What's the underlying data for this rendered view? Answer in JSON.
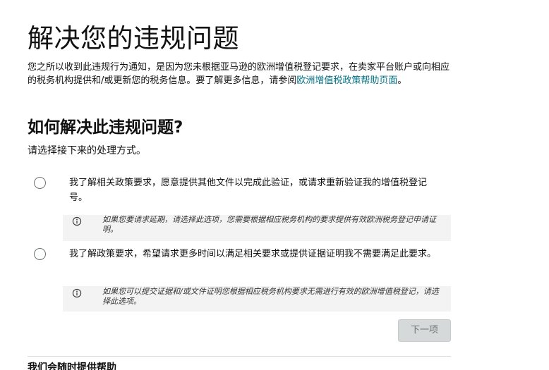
{
  "page": {
    "title": "解决您的违规问题",
    "intro_text": "您之所以收到此违规行为通知，是因为您未根据亚马逊的欧洲增值税登记要求，在卖家平台账户或向相应的税务机构提供和/或更新您的税务信息。要了解更多信息，请参阅",
    "intro_link": "欧洲增值税政策帮助页面",
    "intro_end": "。"
  },
  "resolution": {
    "title": "如何解决此违规问题?",
    "subtitle": "请选择接下来的处理方式。",
    "options": [
      {
        "label": "我了解相关政策要求，愿意提供其他文件以完成此验证，或请求重新验证我的增值税登记号。",
        "note": "如果您要请求延期，请选择此选项，您需要根据相应税务机构的要求提供有效欧洲税务登记申请证明。",
        "selected": false
      },
      {
        "label": "我了解政策要求，希望请求更多时间以满足相关要求或提供证据证明我不需要满足此要求。",
        "note": "如果您可以提交证据和/或文件证明您根据相应税务机构要求无需进行有效的欧洲增值税登记，请选择此选项。",
        "selected": false
      }
    ],
    "next_label": "下一项"
  },
  "footer": {
    "help_heading": "我们会随时提供帮助"
  },
  "colors": {
    "link": "#007185",
    "disabled_button_bg": "#d5d9d9",
    "note_bg": "#f3f3f3"
  },
  "icons": {
    "note_icon": "info-icon",
    "option_control": "radio-button"
  }
}
